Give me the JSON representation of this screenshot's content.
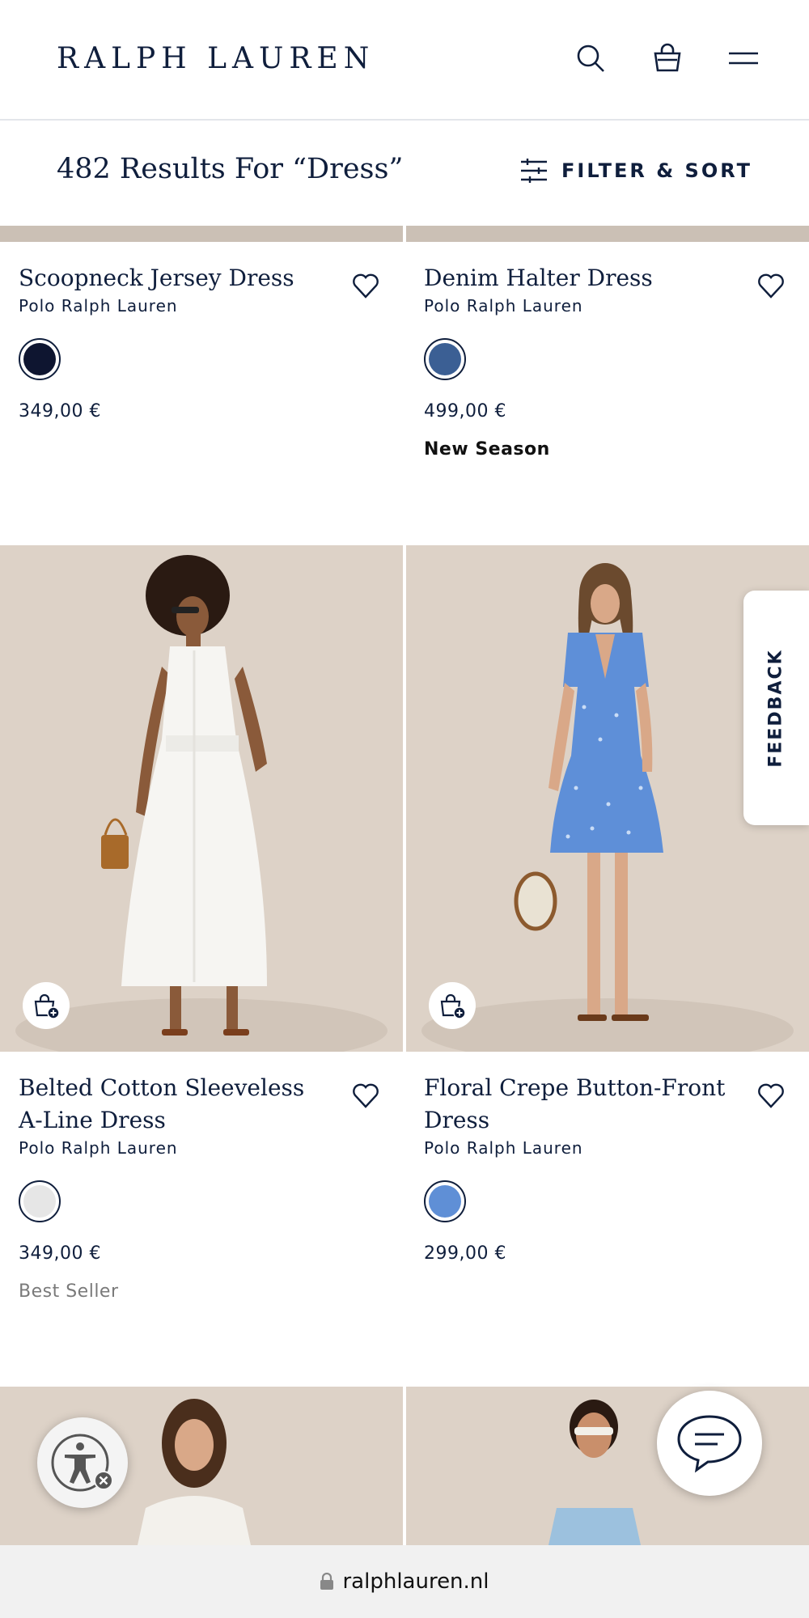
{
  "header": {
    "logo": "RALPH LAUREN",
    "icons": [
      "search-icon",
      "shopping-bag-icon",
      "hamburger-menu-icon"
    ]
  },
  "results": {
    "title": "482 Results For “Dress”",
    "filter_label": "FILTER & SORT"
  },
  "products": [
    {
      "name": "Scoopneck Jersey Dress",
      "brand": "Polo Ralph Lauren",
      "swatch_color": "#0e1530",
      "price": "349,00 €",
      "badge": ""
    },
    {
      "name": "Denim Halter Dress",
      "brand": "Polo Ralph Lauren",
      "swatch_color": "#3b5f94",
      "price": "499,00 €",
      "badge": "New Season"
    },
    {
      "name": "Belted Cotton Sleeveless A-Line Dress",
      "brand": "Polo Ralph Lauren",
      "swatch_color": "#e6e6e6",
      "price": "349,00 €",
      "badge": "Best Seller"
    },
    {
      "name": "Floral Crepe Button-Front Dress",
      "brand": "Polo Ralph Lauren",
      "swatch_color": "#5f8fd6",
      "price": "299,00 €",
      "badge": ""
    }
  ],
  "feedback": {
    "label": "FEEDBACK"
  },
  "browser": {
    "url": "ralphlauren.nl"
  },
  "colors": {
    "navy": "#0f1e3c",
    "image_background": "#ded3c9",
    "badge_gray": "#7a7a7a"
  }
}
